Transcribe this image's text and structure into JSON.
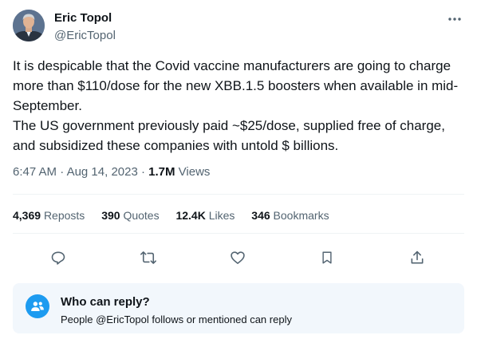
{
  "author": {
    "name": "Eric Topol",
    "handle": "@EricTopol"
  },
  "tweet": {
    "paragraph_1": "It is despicable that the Covid vaccine manufacturers are going to charge more than $110/dose for the new XBB.1.5 boosters when available in mid-September.",
    "paragraph_2": "The US government previously paid ~$25/dose, supplied free of charge, and subsidized these companies with untold $ billions."
  },
  "meta": {
    "time": "6:47 AM",
    "separator_1": " · ",
    "date": "Aug 14, 2023",
    "separator_2": " · ",
    "views_count": "1.7M",
    "views_label": " Views"
  },
  "stats": [
    {
      "count": "4,369",
      "label": "Reposts"
    },
    {
      "count": "390",
      "label": "Quotes"
    },
    {
      "count": "12.4K",
      "label": "Likes"
    },
    {
      "count": "346",
      "label": "Bookmarks"
    }
  ],
  "actions": {
    "icons": [
      "reply-icon",
      "retweet-icon",
      "like-icon",
      "bookmark-icon",
      "share-icon"
    ]
  },
  "reply_settings": {
    "title": "Who can reply?",
    "description": "People @EricTopol follows or mentioned can reply",
    "icon": "people-icon"
  },
  "colors": {
    "accent": "#1d9bf0",
    "secondary_text": "#536471",
    "primary_text": "#0f1419",
    "reply_box_bg": "#f2f7fc"
  }
}
